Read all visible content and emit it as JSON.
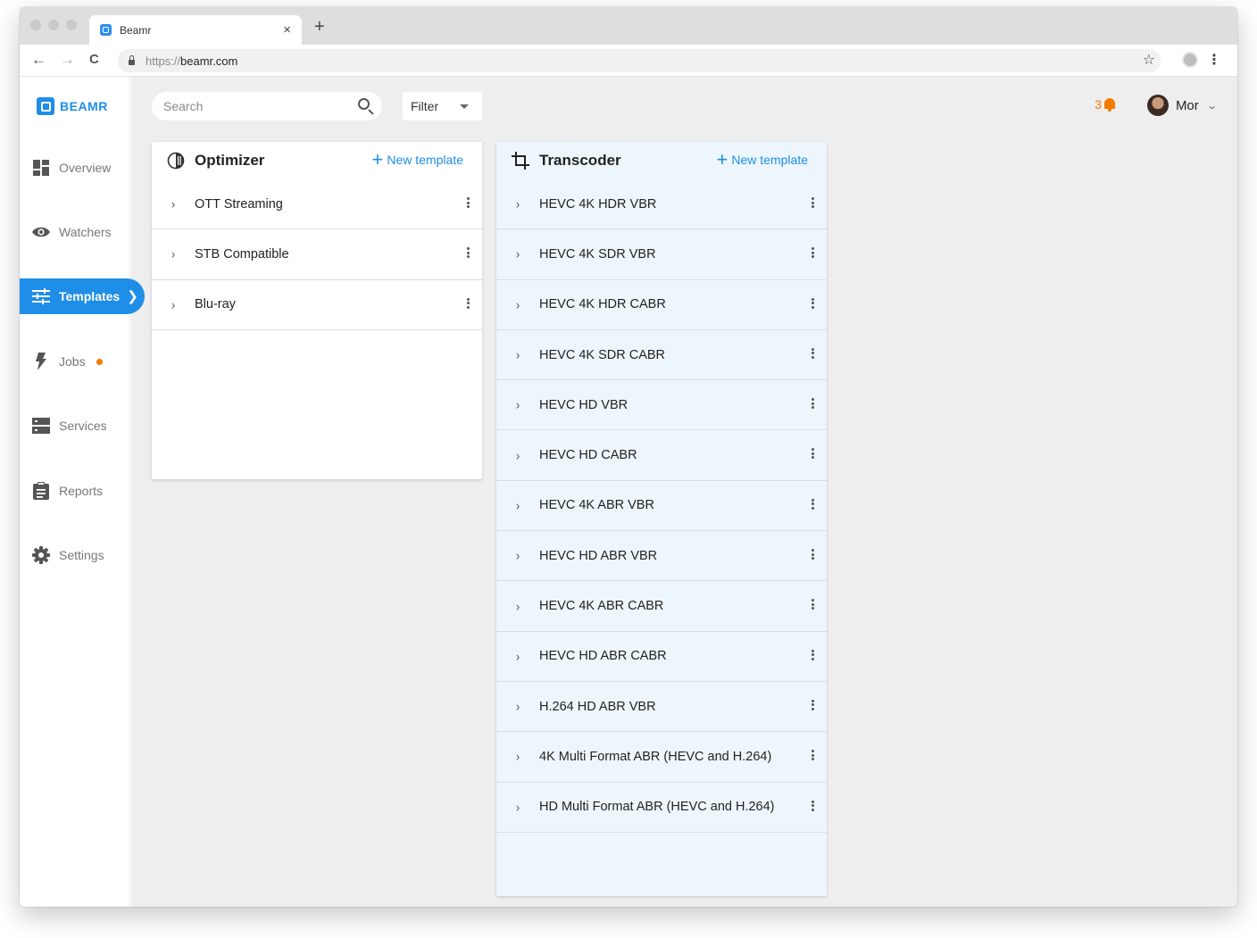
{
  "browser": {
    "tab_title": "Beamr",
    "tab_close": "×",
    "new_tab": "+",
    "url_scheme": "https://",
    "url_host": "beamr.com",
    "back": "←",
    "forward": "→",
    "reload": "C",
    "bookmark": "☆",
    "menu": "⋮"
  },
  "brand": {
    "name": "BEAMR",
    "accent": "#1e8ee8",
    "notification_color": "#f57c00"
  },
  "sidebar": {
    "items": [
      {
        "label": "Overview",
        "icon": "dashboard-icon",
        "active": false
      },
      {
        "label": "Watchers",
        "icon": "eye-icon",
        "active": false
      },
      {
        "label": "Templates",
        "icon": "sliders-icon",
        "active": true
      },
      {
        "label": "Jobs",
        "icon": "lightning-icon",
        "active": false,
        "badge_dot": true
      },
      {
        "label": "Services",
        "icon": "server-icon",
        "active": false
      },
      {
        "label": "Reports",
        "icon": "clipboard-icon",
        "active": false
      },
      {
        "label": "Settings",
        "icon": "gear-icon",
        "active": false
      }
    ]
  },
  "toolbar": {
    "search_placeholder": "Search",
    "filter_label": "Filter",
    "notification_count": "3",
    "user_name": "Mor"
  },
  "optimizer": {
    "title": "Optimizer",
    "new_template_label": "New template",
    "items": [
      "OTT Streaming",
      "STB Compatible",
      "Blu-ray"
    ]
  },
  "transcoder": {
    "title": "Transcoder",
    "new_template_label": "New template",
    "items": [
      "HEVC 4K HDR VBR",
      "HEVC 4K SDR VBR",
      "HEVC 4K HDR CABR",
      "HEVC 4K SDR CABR",
      "HEVC HD VBR",
      "HEVC HD CABR",
      "HEVC 4K ABR VBR",
      "HEVC HD ABR VBR",
      "HEVC 4K ABR CABR",
      "HEVC HD ABR CABR",
      "H.264 HD ABR VBR",
      "4K Multi Format ABR (HEVC and H.264)",
      "HD Multi Format ABR (HEVC and H.264)"
    ]
  }
}
